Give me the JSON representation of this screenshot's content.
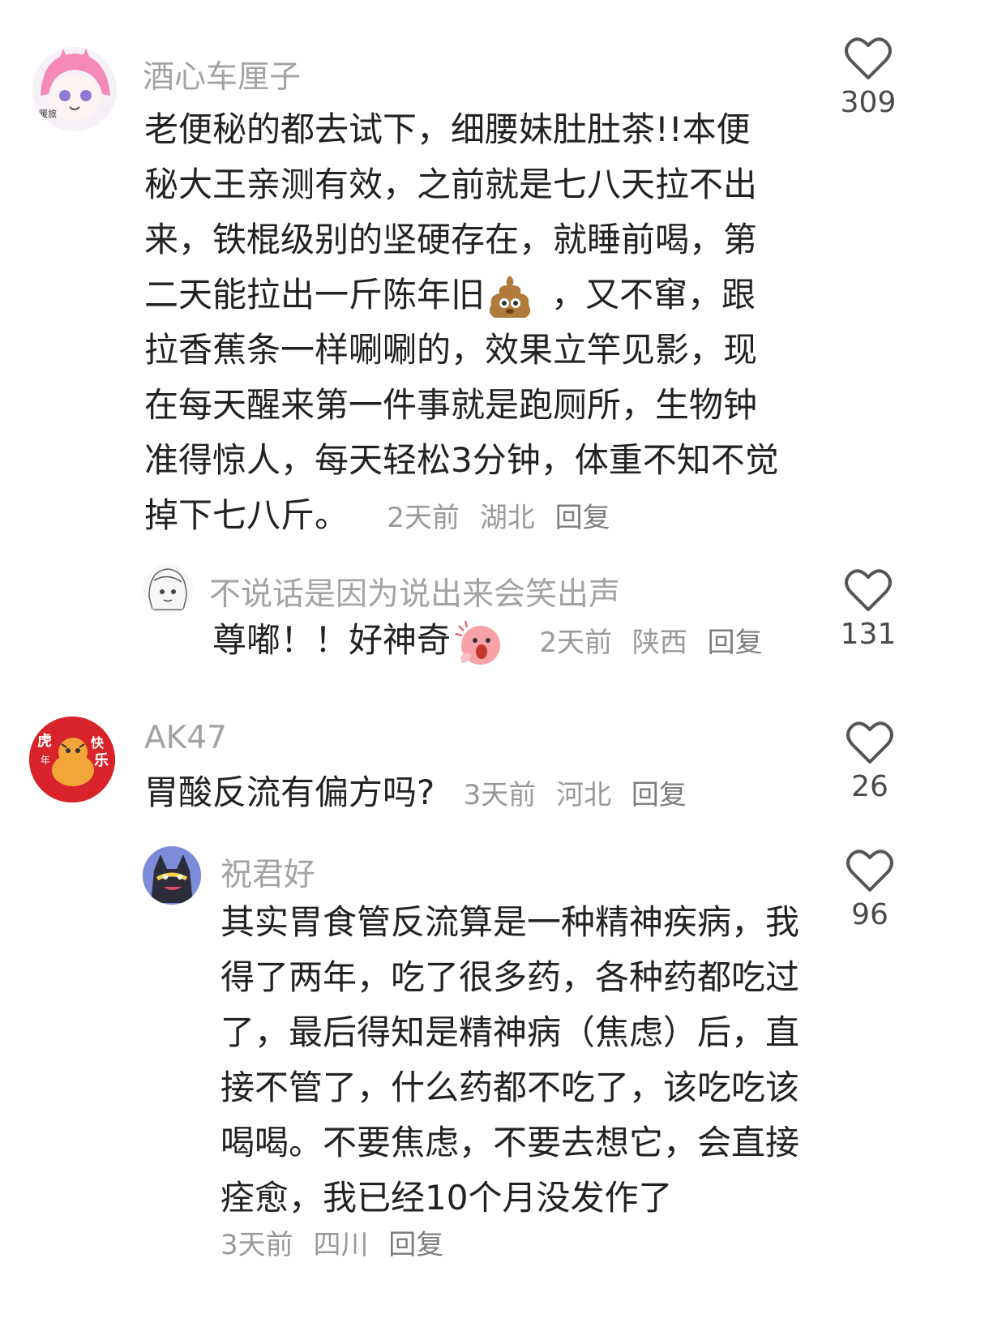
{
  "comments": [
    {
      "username": "酒心车厘子",
      "lines": [
        "老便秘的都去试下，细腰妹肚肚茶!!本便",
        "秘大王亲测有效，之前就是七八天拉不出",
        "来，铁棍级别的坚硬存在，就睡前喝，第",
        "二天能拉出一斤陈年旧",
        "，又不窜，跟",
        "拉香蕉条一样唰唰的，效果立竿见影，现",
        "在每天醒来第一件事就是跑厕所，生物钟",
        "准得惊人，每天轻松3分钟，体重不知不觉",
        "掉下七八斤。"
      ],
      "time": "2天前",
      "location": "湖北",
      "reply_label": "回复",
      "likes": "309",
      "avatar_text": "暖旅"
    },
    {
      "username": "不说话是因为说出来会笑出声",
      "text": "尊嘟！！好神奇",
      "time": "2天前",
      "location": "陕西",
      "reply_label": "回复",
      "likes": "131"
    },
    {
      "username": "AK47",
      "text": "胃酸反流有偏方吗?",
      "time": "3天前",
      "location": "河北",
      "reply_label": "回复",
      "likes": "26",
      "avatar_text": [
        "虎",
        "年",
        "快",
        "乐"
      ]
    },
    {
      "username": "祝君好",
      "lines": [
        "其实胃食管反流算是一种精神疾病，我",
        "得了两年，吃了很多药，各种药都吃过",
        "了，最后得知是精神病（焦虑）后，直",
        "接不管了，什么药都不吃了，该吃吃该",
        "喝喝。不要焦虑，不要去想它，会直接",
        "痊愈，我已经10个月没发作了"
      ],
      "time": "3天前",
      "location": "四川",
      "reply_label": "回复",
      "likes": "96"
    }
  ],
  "colors": {
    "text": "#222222",
    "username": "#a3a3a3",
    "meta": "#9a9a9a",
    "heart": "#555555",
    "ak47_avatar_bg": "#d8232a"
  },
  "icons": [
    "heart-icon",
    "poop-emoji",
    "surprised-emoji"
  ]
}
